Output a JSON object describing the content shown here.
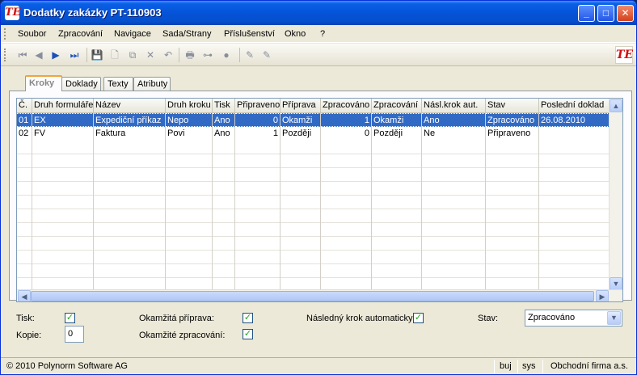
{
  "window": {
    "title": "Dodatky zakázky  PT-110903",
    "logo": "TE",
    "controls": {
      "minimize": "_",
      "maximize": "□",
      "close": "✕"
    }
  },
  "menu": [
    "Soubor",
    "Zpracování",
    "Navigace",
    "Sada/Strany",
    "Příslušenství",
    "Okno",
    "?"
  ],
  "toolbar": {
    "buttons": [
      {
        "name": "first-record-icon",
        "glyph": "⏮",
        "enabled": false
      },
      {
        "name": "previous-record-icon",
        "glyph": "◀",
        "enabled": false
      },
      {
        "name": "next-record-icon",
        "glyph": "▶",
        "enabled": true
      },
      {
        "name": "last-record-icon",
        "glyph": "⏭",
        "enabled": true
      },
      {
        "name": "save-icon",
        "glyph": "💾",
        "enabled": false
      },
      {
        "name": "new-document-icon",
        "glyph": "🗋",
        "enabled": false
      },
      {
        "name": "copy-icon",
        "glyph": "⧉",
        "enabled": false
      },
      {
        "name": "delete-icon",
        "glyph": "✕",
        "enabled": false
      },
      {
        "name": "undo-icon",
        "glyph": "↶",
        "enabled": false
      },
      {
        "name": "print-icon",
        "glyph": "🖶",
        "enabled": false
      },
      {
        "name": "tree-icon",
        "glyph": "⊶",
        "enabled": false
      },
      {
        "name": "help-icon",
        "glyph": "●",
        "enabled": false
      },
      {
        "name": "edit-pencil-icon",
        "glyph": "✎",
        "enabled": false
      },
      {
        "name": "edit-pencil-2-icon",
        "glyph": "✎",
        "enabled": false
      }
    ],
    "logo": "TE"
  },
  "tabs": [
    {
      "label": "Kroky",
      "active": true
    },
    {
      "label": "Doklady",
      "active": false
    },
    {
      "label": "Texty",
      "active": false
    },
    {
      "label": "Atributy",
      "active": false
    }
  ],
  "grid": {
    "columns": [
      "Č.",
      "Druh formuláře",
      "Název",
      "Druh kroku",
      "Tisk",
      "Připraveno",
      "Příprava",
      "Zpracováno",
      "Zpracování",
      "Násl.krok aut.",
      "Stav",
      "Poslední doklad"
    ],
    "rows": [
      [
        "01",
        "EX",
        "Expediční příkaz",
        "Nepo",
        "Ano",
        "0",
        "Okamži",
        "1",
        "Okamži",
        "Ano",
        "Zpracováno",
        "26.08.2010"
      ],
      [
        "02",
        "FV",
        "Faktura",
        "Povi",
        "Ano",
        "1",
        "Později",
        "0",
        "Později",
        "Ne",
        "Připraveno",
        ""
      ]
    ],
    "selected_row": 0,
    "scroll_glyphs": {
      "up": "▲",
      "down": "▼",
      "left": "◀",
      "right": "▶"
    }
  },
  "form": {
    "tisk_label": "Tisk:",
    "tisk_checked": true,
    "kopie_label": "Kopie:",
    "kopie_value": "0",
    "okamzita_priprava_label": "Okamžitá příprava:",
    "okamzita_priprava_checked": true,
    "okamzite_zpracovani_label": "Okamžité zpracování:",
    "okamzite_zpracovani_checked": true,
    "nasledny_krok_label": "Následný krok automaticky",
    "nasledny_krok_checked": true,
    "stav_label": "Stav:",
    "stav_value": "Zpracováno",
    "check_glyph": "✓",
    "combo_arrow": "▼"
  },
  "status": {
    "copyright": "© 2010 Polynorm Software AG",
    "user": "buj",
    "system": "sys",
    "company": "Obchodní firma a.s."
  }
}
